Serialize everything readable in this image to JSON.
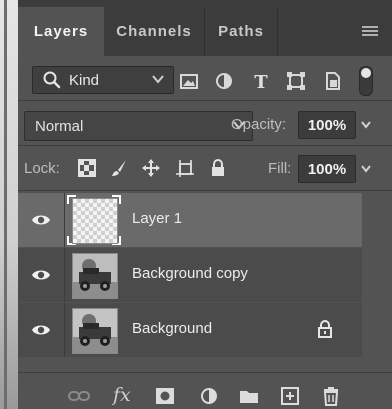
{
  "tabs": [
    {
      "label": "Layers",
      "active": true
    },
    {
      "label": "Channels",
      "active": false
    },
    {
      "label": "Paths",
      "active": false
    }
  ],
  "filter": {
    "kind_label": "Kind",
    "icons": [
      "pixel-filter-icon",
      "adjustment-filter-icon",
      "type-filter-icon",
      "shape-filter-icon",
      "smart-object-filter-icon"
    ],
    "toggle_on": true
  },
  "blend": {
    "mode": "Normal",
    "opacity_label": "Opacity:",
    "opacity_value": "100%"
  },
  "lock": {
    "label": "Lock:",
    "icons": [
      "lock-transparent-pixels-icon",
      "lock-image-pixels-icon",
      "lock-position-icon",
      "lock-artboard-icon",
      "lock-all-icon"
    ],
    "fill_label": "Fill:",
    "fill_value": "100%"
  },
  "layers": [
    {
      "name": "Layer 1",
      "selected": true,
      "visible": true,
      "thumbnail": "transparent",
      "locked": false
    },
    {
      "name": "Background copy",
      "selected": false,
      "visible": true,
      "thumbnail": "photo",
      "locked": false
    },
    {
      "name": "Background",
      "selected": false,
      "visible": true,
      "thumbnail": "photo",
      "locked": true
    }
  ],
  "bottom_toolbar": {
    "fx_label": "fx",
    "icons": [
      "link-layers-icon",
      "layer-style-icon",
      "add-mask-icon",
      "adjustment-layer-icon",
      "new-group-icon",
      "new-layer-icon",
      "delete-layer-icon"
    ]
  },
  "colors": {
    "panel_bg": "#535353",
    "tabbar_bg": "#3c3c3c",
    "row_bg": "#4b4b4b",
    "row_selected_bg": "#6a6a6a",
    "text": "#ececec"
  }
}
